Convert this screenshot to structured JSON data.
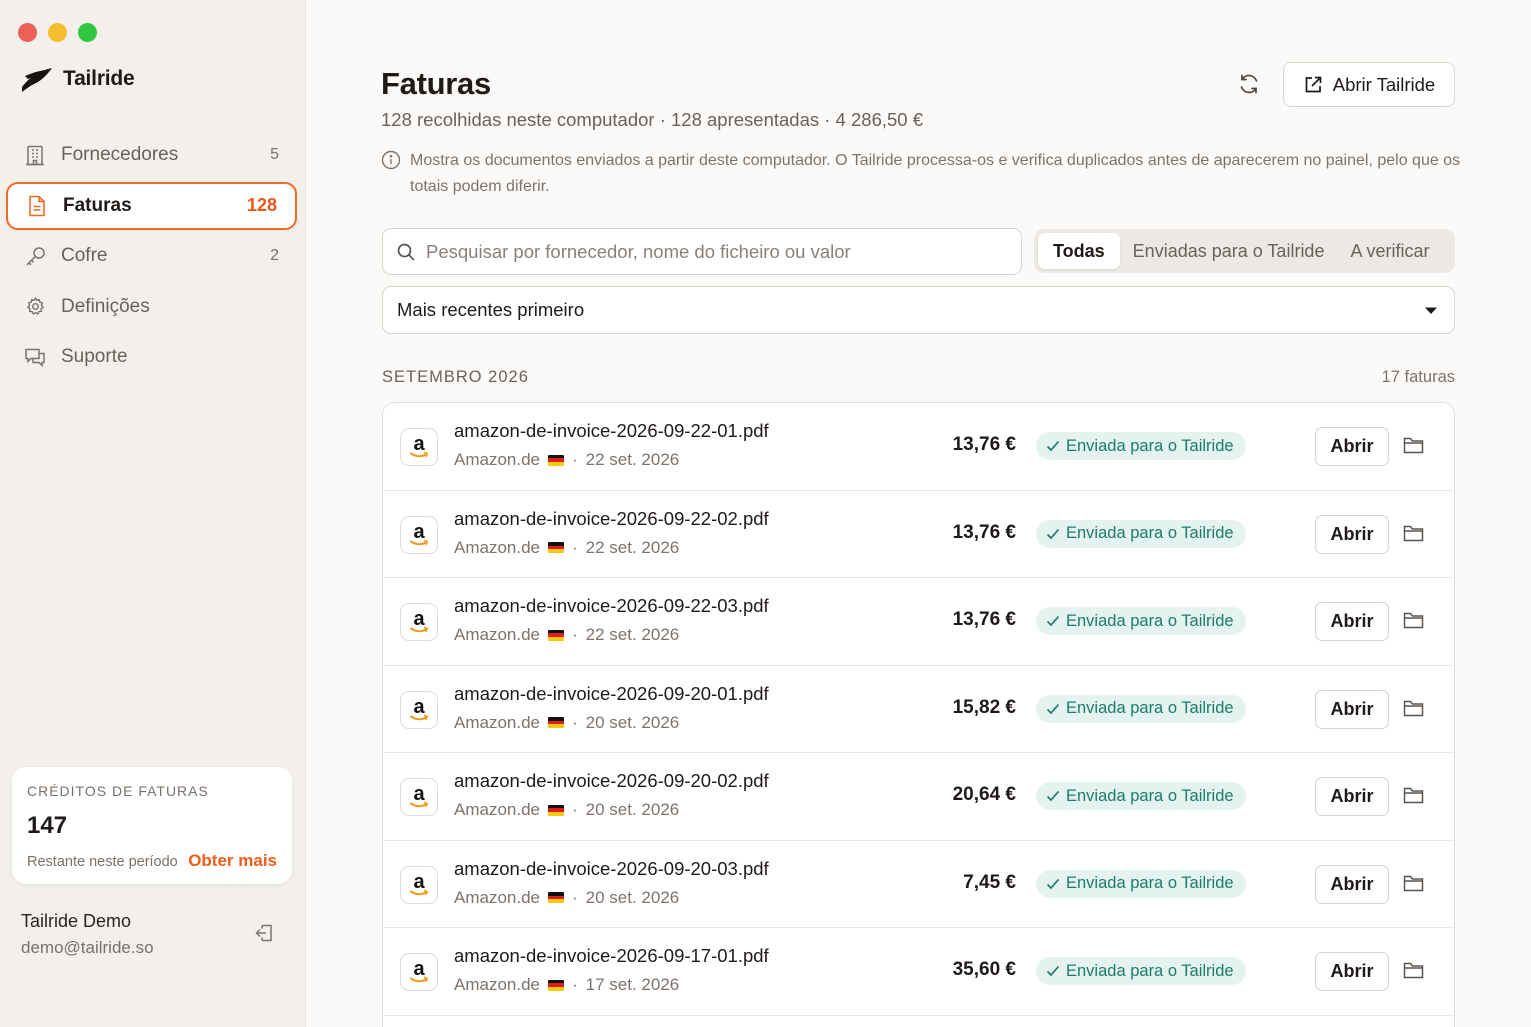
{
  "app": {
    "name": "Tailride"
  },
  "sidebar": {
    "items": [
      {
        "label": "Fornecedores",
        "count": "5",
        "icon": "building-icon"
      },
      {
        "label": "Faturas",
        "count": "128",
        "icon": "document-icon",
        "active": true
      },
      {
        "label": "Cofre",
        "count": "2",
        "icon": "key-icon"
      },
      {
        "label": "Definições",
        "count": "",
        "icon": "gear-icon"
      },
      {
        "label": "Suporte",
        "count": "",
        "icon": "chat-icon"
      }
    ],
    "credits": {
      "title": "CRÉDITOS DE FATURAS",
      "value": "147",
      "remaining_label": "Restante neste período",
      "link": "Obter mais"
    },
    "user": {
      "name": "Tailride Demo",
      "email": "demo@tailride.so"
    }
  },
  "header": {
    "title": "Faturas",
    "subtitle": "128 recolhidas neste computador · 128 apresentadas · 4 286,50 €",
    "open_button": "Abrir Tailride",
    "info": "Mostra os documentos enviados a partir deste computador. O Tailride processa-os e verifica duplicados antes de aparecerem no painel, pelo que os totais podem diferir."
  },
  "filters": {
    "search_placeholder": "Pesquisar por fornecedor, nome do ficheiro ou valor",
    "tabs": [
      "Todas",
      "Enviadas para o Tailride",
      "A verificar"
    ],
    "active_tab": "Todas",
    "sort": "Mais recentes primeiro"
  },
  "group": {
    "title": "SETEMBRO 2026",
    "count": "17 faturas"
  },
  "invoices": [
    {
      "file": "amazon-de-invoice-2026-09-22-01.pdf",
      "vendor": "Amazon.de",
      "date": "22 set. 2026",
      "amount": "13,76 €",
      "status": "Enviada para o Tailride",
      "action": "Abrir"
    },
    {
      "file": "amazon-de-invoice-2026-09-22-02.pdf",
      "vendor": "Amazon.de",
      "date": "22 set. 2026",
      "amount": "13,76 €",
      "status": "Enviada para o Tailride",
      "action": "Abrir"
    },
    {
      "file": "amazon-de-invoice-2026-09-22-03.pdf",
      "vendor": "Amazon.de",
      "date": "22 set. 2026",
      "amount": "13,76 €",
      "status": "Enviada para o Tailride",
      "action": "Abrir"
    },
    {
      "file": "amazon-de-invoice-2026-09-20-01.pdf",
      "vendor": "Amazon.de",
      "date": "20 set. 2026",
      "amount": "15,82 €",
      "status": "Enviada para o Tailride",
      "action": "Abrir"
    },
    {
      "file": "amazon-de-invoice-2026-09-20-02.pdf",
      "vendor": "Amazon.de",
      "date": "20 set. 2026",
      "amount": "20,64 €",
      "status": "Enviada para o Tailride",
      "action": "Abrir"
    },
    {
      "file": "amazon-de-invoice-2026-09-20-03.pdf",
      "vendor": "Amazon.de",
      "date": "20 set. 2026",
      "amount": "7,45 €",
      "status": "Enviada para o Tailride",
      "action": "Abrir"
    },
    {
      "file": "amazon-de-invoice-2026-09-17-01.pdf",
      "vendor": "Amazon.de",
      "date": "17 set. 2026",
      "amount": "35,60 €",
      "status": "Enviada para o Tailride",
      "action": "Abrir"
    }
  ],
  "colors": {
    "accent": "#ef6a25",
    "status_bg": "#e4f3ef",
    "status_text": "#1b7c6a"
  }
}
